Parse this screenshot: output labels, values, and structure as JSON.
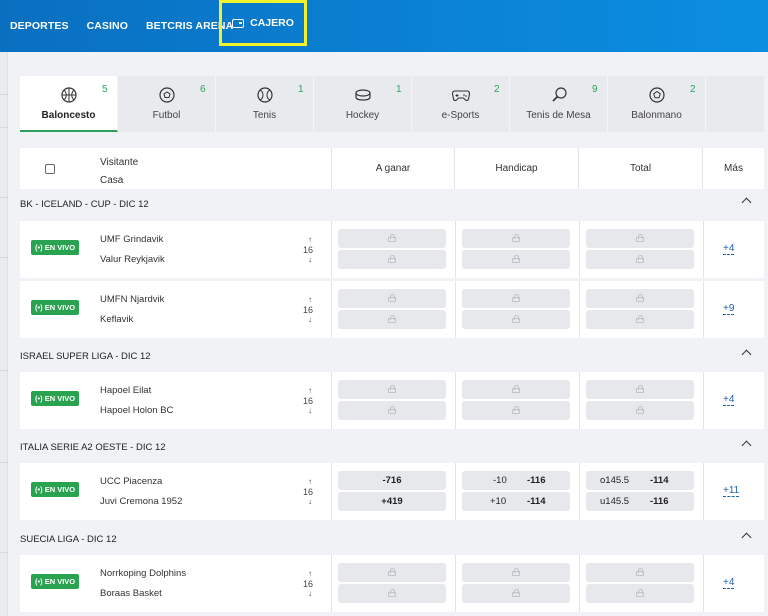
{
  "nav": {
    "deportes": "DEPORTES",
    "casino": "CASINO",
    "arena": "BETCRIS ARENA",
    "cajero": "CAJERO"
  },
  "sports": [
    {
      "name": "Baloncesto",
      "count": "5",
      "icon": "basketball-icon"
    },
    {
      "name": "Futbol",
      "count": "6",
      "icon": "soccer-icon"
    },
    {
      "name": "Tenis",
      "count": "1",
      "icon": "tennis-icon"
    },
    {
      "name": "Hockey",
      "count": "1",
      "icon": "hockey-icon"
    },
    {
      "name": "e-Sports",
      "count": "2",
      "icon": "gamepad-icon"
    },
    {
      "name": "Tenis de Mesa",
      "count": "9",
      "icon": "ping-pong-icon"
    },
    {
      "name": "Balonmano",
      "count": "2",
      "icon": "handball-icon"
    }
  ],
  "header": {
    "visitante": "Visitante",
    "casa": "Casa",
    "a_ganar": "A ganar",
    "handicap": "Handicap",
    "total": "Total",
    "mas": "Más"
  },
  "live_label": "EN VIVO",
  "leagues": [
    {
      "name": "BK - ICELAND - CUP - DIC 12"
    },
    {
      "name": "ISRAEL SUPER LIGA - DIC 12"
    },
    {
      "name": "ITALIA SERIE A2 OESTE - DIC 12"
    },
    {
      "name": "SUECIA LIGA - DIC 12"
    }
  ],
  "games": [
    {
      "team1": "UMF Grindavik",
      "team2": "Valur Reykjavik",
      "stat": "16",
      "more": "+4",
      "locked": true
    },
    {
      "team1": "UMFN Njardvik",
      "team2": "Keflavik",
      "stat": "16",
      "more": "+9",
      "locked": true
    },
    {
      "team1": "Hapoel Eilat",
      "team2": "Hapoel Holon BC",
      "stat": "16",
      "more": "+4",
      "locked": true
    },
    {
      "team1": "UCC Piacenza",
      "team2": "Juvi Cremona 1952",
      "stat": "16",
      "more": "+11",
      "locked": false,
      "odds": {
        "ml1": "-716",
        "ml2": "+419",
        "hc1_line": "-10",
        "hc1_odds": "-116",
        "hc2_line": "+10",
        "hc2_odds": "-114",
        "tot1_line": "o145.5",
        "tot1_odds": "-114",
        "tot2_line": "u145.5",
        "tot2_odds": "-116"
      }
    },
    {
      "team1": "Norrkoping Dolphins",
      "team2": "Boraas Basket",
      "stat": "16",
      "more": "+4",
      "locked": true
    }
  ]
}
